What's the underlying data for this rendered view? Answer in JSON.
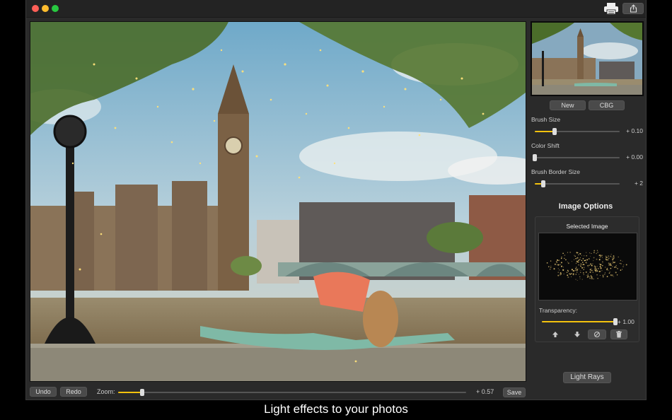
{
  "toolbar": {
    "undo_label": "Undo",
    "redo_label": "Redo",
    "zoom_label": "Zoom:",
    "zoom_value": "+ 0.57",
    "zoom_fraction": 0.07,
    "save_label": "Save",
    "print_icon": "printer-icon",
    "share_icon": "share-icon"
  },
  "sidebar": {
    "new_label": "New",
    "cbg_label": "CBG",
    "params": [
      {
        "label": "Brush Size",
        "value": "+ 0.10",
        "fraction": 0.23
      },
      {
        "label": "Color Shift",
        "value": "+ 0.00",
        "fraction": 0.0
      },
      {
        "label": "Brush Border Size",
        "value": "+ 2",
        "fraction": 0.1
      }
    ],
    "image_options": {
      "title": "Image Options",
      "selected_label": "Selected Image",
      "transparency_label": "Transparency:",
      "transparency_value": "+ 1.00",
      "transparency_fraction": 1.0,
      "icons": [
        "arrow-up-icon",
        "arrow-down-icon",
        "reset-icon",
        "trash-icon"
      ]
    },
    "light_rays_label": "Light Rays"
  },
  "colors": {
    "accent": "#f4c20d",
    "window_bg": "#2a2a2a",
    "button_bg": "#4a4a4a"
  },
  "caption": "Light effects to your photos"
}
